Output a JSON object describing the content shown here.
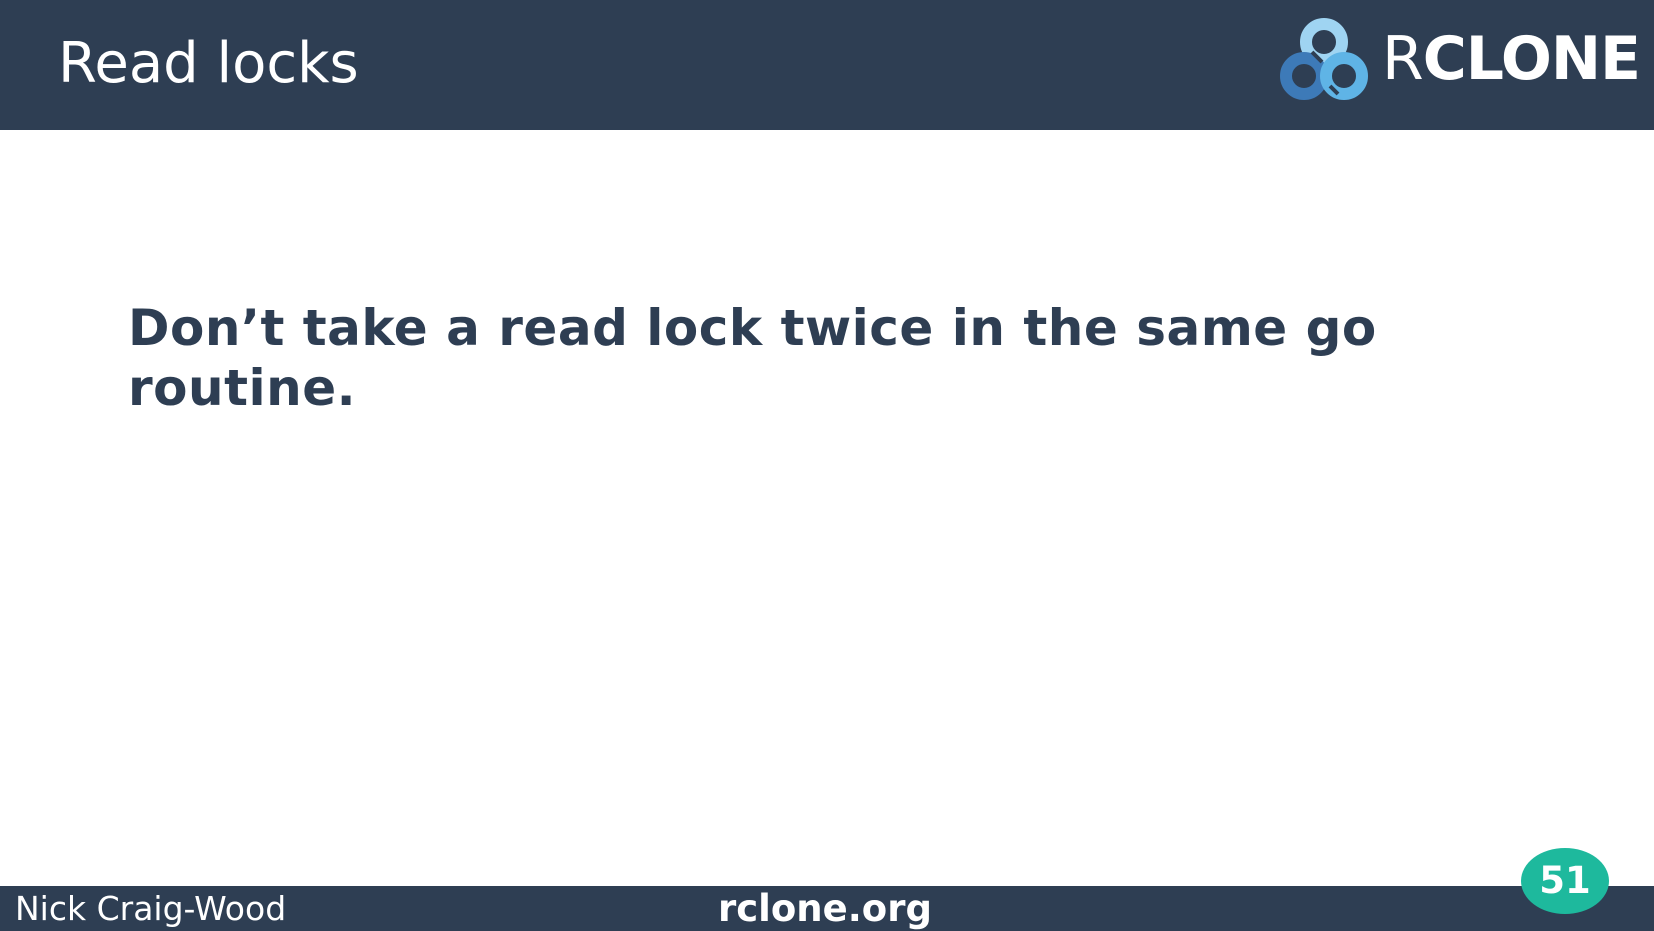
{
  "header": {
    "title": "Read locks",
    "logo": {
      "mark_icon": "rclone-logo-icon",
      "text_first": "R",
      "text_rest": "CLONE"
    }
  },
  "main": {
    "text": "Don’t take a read lock twice in the same go routine."
  },
  "footer": {
    "author": "Nick Craig-Wood",
    "site": "rclone.org",
    "page_number": "51"
  },
  "colors": {
    "header_bg": "#2e3e53",
    "text_dark": "#2e3e53",
    "badge": "#1eb99d",
    "logo_light_blue": "#9fd4f2",
    "logo_mid_blue": "#5fb4e6",
    "logo_dark_blue": "#3d7ab8"
  }
}
